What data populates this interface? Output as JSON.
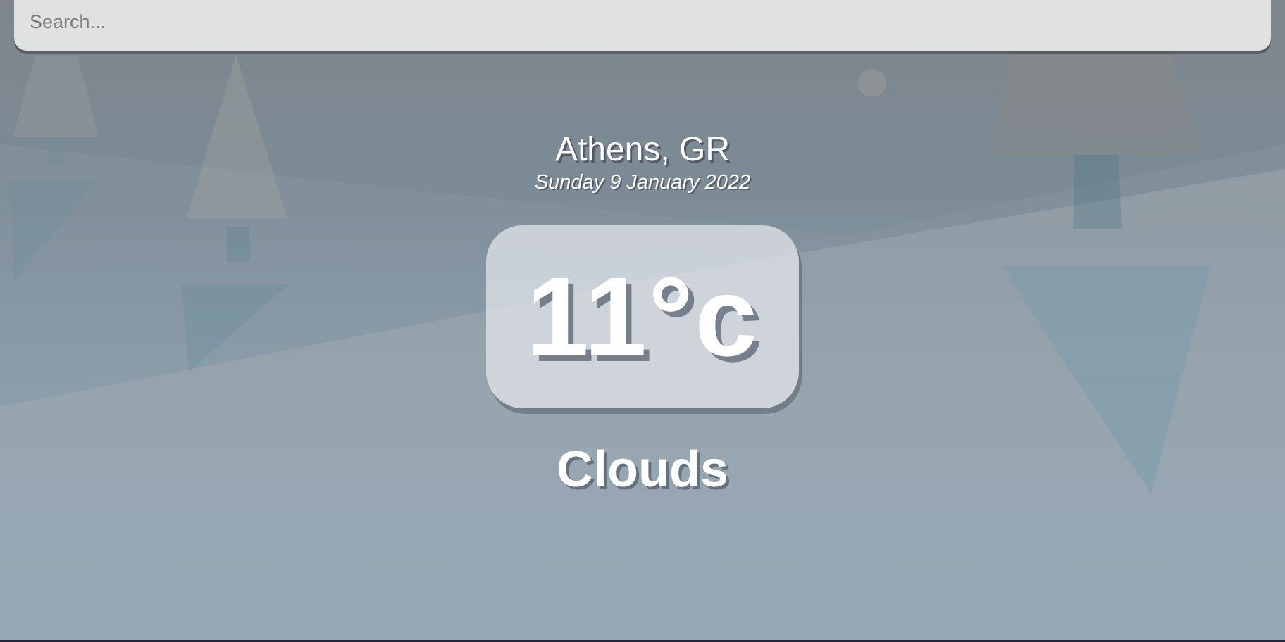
{
  "search": {
    "placeholder": "Search...",
    "value": ""
  },
  "location": {
    "city": "Athens, GR",
    "date": "Sunday 9 January 2022"
  },
  "weather": {
    "temperature": "11°c",
    "condition": "Clouds"
  },
  "colors": {
    "search_bg": "#e0e2e1",
    "background_top": "#7e858c",
    "background_bottom": "#88adca",
    "text": "#ffffff"
  },
  "icons": [
    "tree-decoration",
    "sun-decoration"
  ]
}
